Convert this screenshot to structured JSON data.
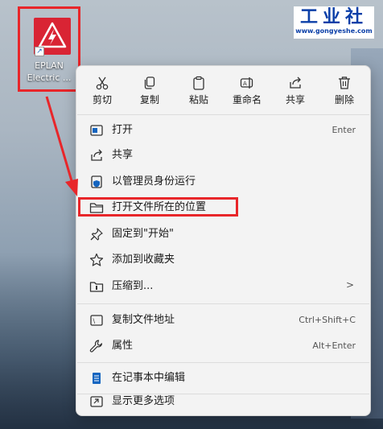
{
  "desktop_icon": {
    "label_line1": "EPLAN",
    "label_line2": "Electric ..."
  },
  "logo": {
    "title": "工业社",
    "url": "www.gongyeshe.com"
  },
  "quick_actions": [
    {
      "label": "剪切",
      "icon": "scissors-icon"
    },
    {
      "label": "复制",
      "icon": "copy-icon"
    },
    {
      "label": "粘贴",
      "icon": "paste-icon"
    },
    {
      "label": "重命名",
      "icon": "rename-icon"
    },
    {
      "label": "共享",
      "icon": "share-icon"
    },
    {
      "label": "删除",
      "icon": "trash-icon"
    }
  ],
  "menu_items": [
    {
      "label": "打开",
      "shortcut": "Enter",
      "icon": "open-icon"
    },
    {
      "label": "共享",
      "shortcut": "",
      "icon": "share-icon"
    },
    {
      "label": "以管理员身份运行",
      "shortcut": "",
      "icon": "shield-icon"
    },
    {
      "label": "打开文件所在的位置",
      "shortcut": "",
      "icon": "folder-icon"
    },
    {
      "label": "固定到\"开始\"",
      "shortcut": "",
      "icon": "pin-icon"
    },
    {
      "label": "添加到收藏夹",
      "shortcut": "",
      "icon": "star-icon"
    },
    {
      "label": "压缩到...",
      "shortcut": "",
      "icon": "zip-folder-icon"
    },
    {
      "label": "复制文件地址",
      "shortcut": "Ctrl+Shift+C",
      "icon": "copy-path-icon"
    },
    {
      "label": "属性",
      "shortcut": "Alt+Enter",
      "icon": "wrench-icon"
    },
    {
      "label": "在记事本中编辑",
      "shortcut": "",
      "icon": "notepad-icon"
    },
    {
      "label": "显示更多选项",
      "shortcut": "",
      "icon": "more-options-icon"
    }
  ],
  "colors": {
    "highlight": "#e8262a",
    "app_tile": "#d92434",
    "logo_text": "#0b3fa8",
    "icon_blue": "#1565c0"
  }
}
